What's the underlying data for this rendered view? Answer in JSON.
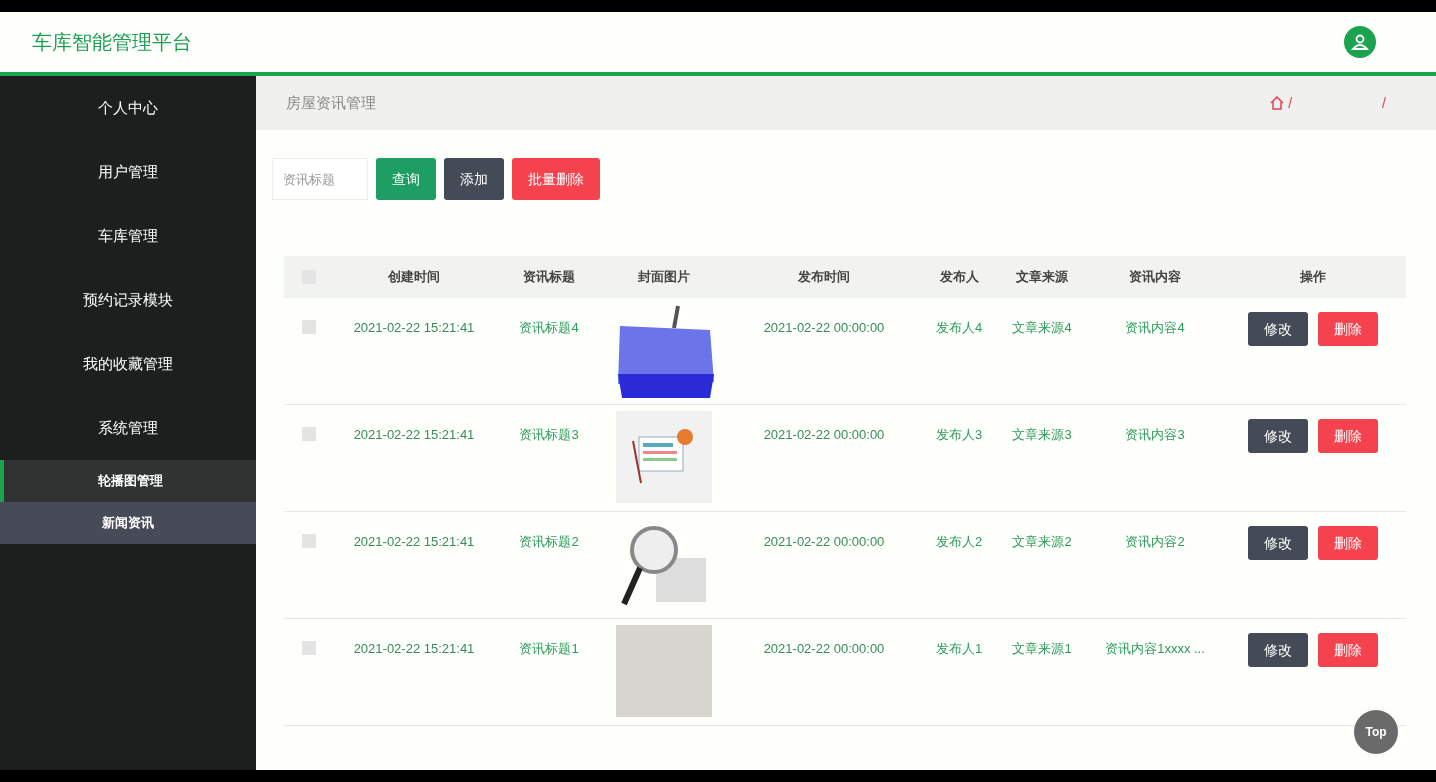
{
  "header": {
    "title": "车库智能管理平台"
  },
  "sidebar": {
    "items": [
      {
        "label": "个人中心"
      },
      {
        "label": "用户管理"
      },
      {
        "label": "车库管理"
      },
      {
        "label": "预约记录模块"
      },
      {
        "label": "我的收藏管理"
      },
      {
        "label": "系统管理",
        "children": [
          {
            "label": "轮播图管理",
            "selected": true
          },
          {
            "label": "新闻资讯",
            "selected": false
          }
        ]
      }
    ]
  },
  "page": {
    "title": "房屋资讯管理",
    "breadcrumb": [
      "/",
      "/"
    ]
  },
  "search": {
    "placeholder": "资讯标题"
  },
  "buttons": [
    {
      "label": "查询",
      "kind": "primary"
    },
    {
      "label": "添加",
      "kind": "neutral"
    },
    {
      "label": "批量删除",
      "kind": "danger"
    }
  ],
  "table": {
    "select_all": {
      "checked": false
    },
    "columns": [
      "创建时间",
      "资讯标题",
      "封面图片",
      "发布时间",
      "发布人",
      "文章来源",
      "资讯内容",
      "操作"
    ],
    "rows": [
      {
        "checked": false,
        "created": "2021-02-22 15:21:41",
        "title": "资讯标题4",
        "kind": "news-key",
        "published": "2021-02-22 00:00:00",
        "author": "发布人4",
        "source": "文章来源4",
        "content": "资讯内容4",
        "actions": [
          "修改",
          "删除"
        ]
      },
      {
        "checked": false,
        "created": "2021-02-22 15:21:41",
        "title": "资讯标题3",
        "kind": "news-paper",
        "published": "2021-02-22 00:00:00",
        "author": "发布人3",
        "source": "文章来源3",
        "content": "资讯内容3",
        "actions": [
          "修改",
          "删除"
        ]
      },
      {
        "checked": false,
        "created": "2021-02-22 15:21:41",
        "title": "资讯标题2",
        "kind": "magnifier",
        "published": "2021-02-22 00:00:00",
        "author": "发布人2",
        "source": "文章来源2",
        "content": "资讯内容2",
        "actions": [
          "修改",
          "删除"
        ]
      },
      {
        "checked": false,
        "created": "2021-02-22 15:21:41",
        "title": "资讯标题1",
        "kind": "blurred",
        "published": "2021-02-22 00:00:00",
        "author": "发布人1",
        "source": "文章来源1",
        "content": "资讯内容1xxxx ...",
        "actions": [
          "修改",
          "删除"
        ]
      }
    ]
  },
  "top_button": {
    "label": "Top"
  }
}
